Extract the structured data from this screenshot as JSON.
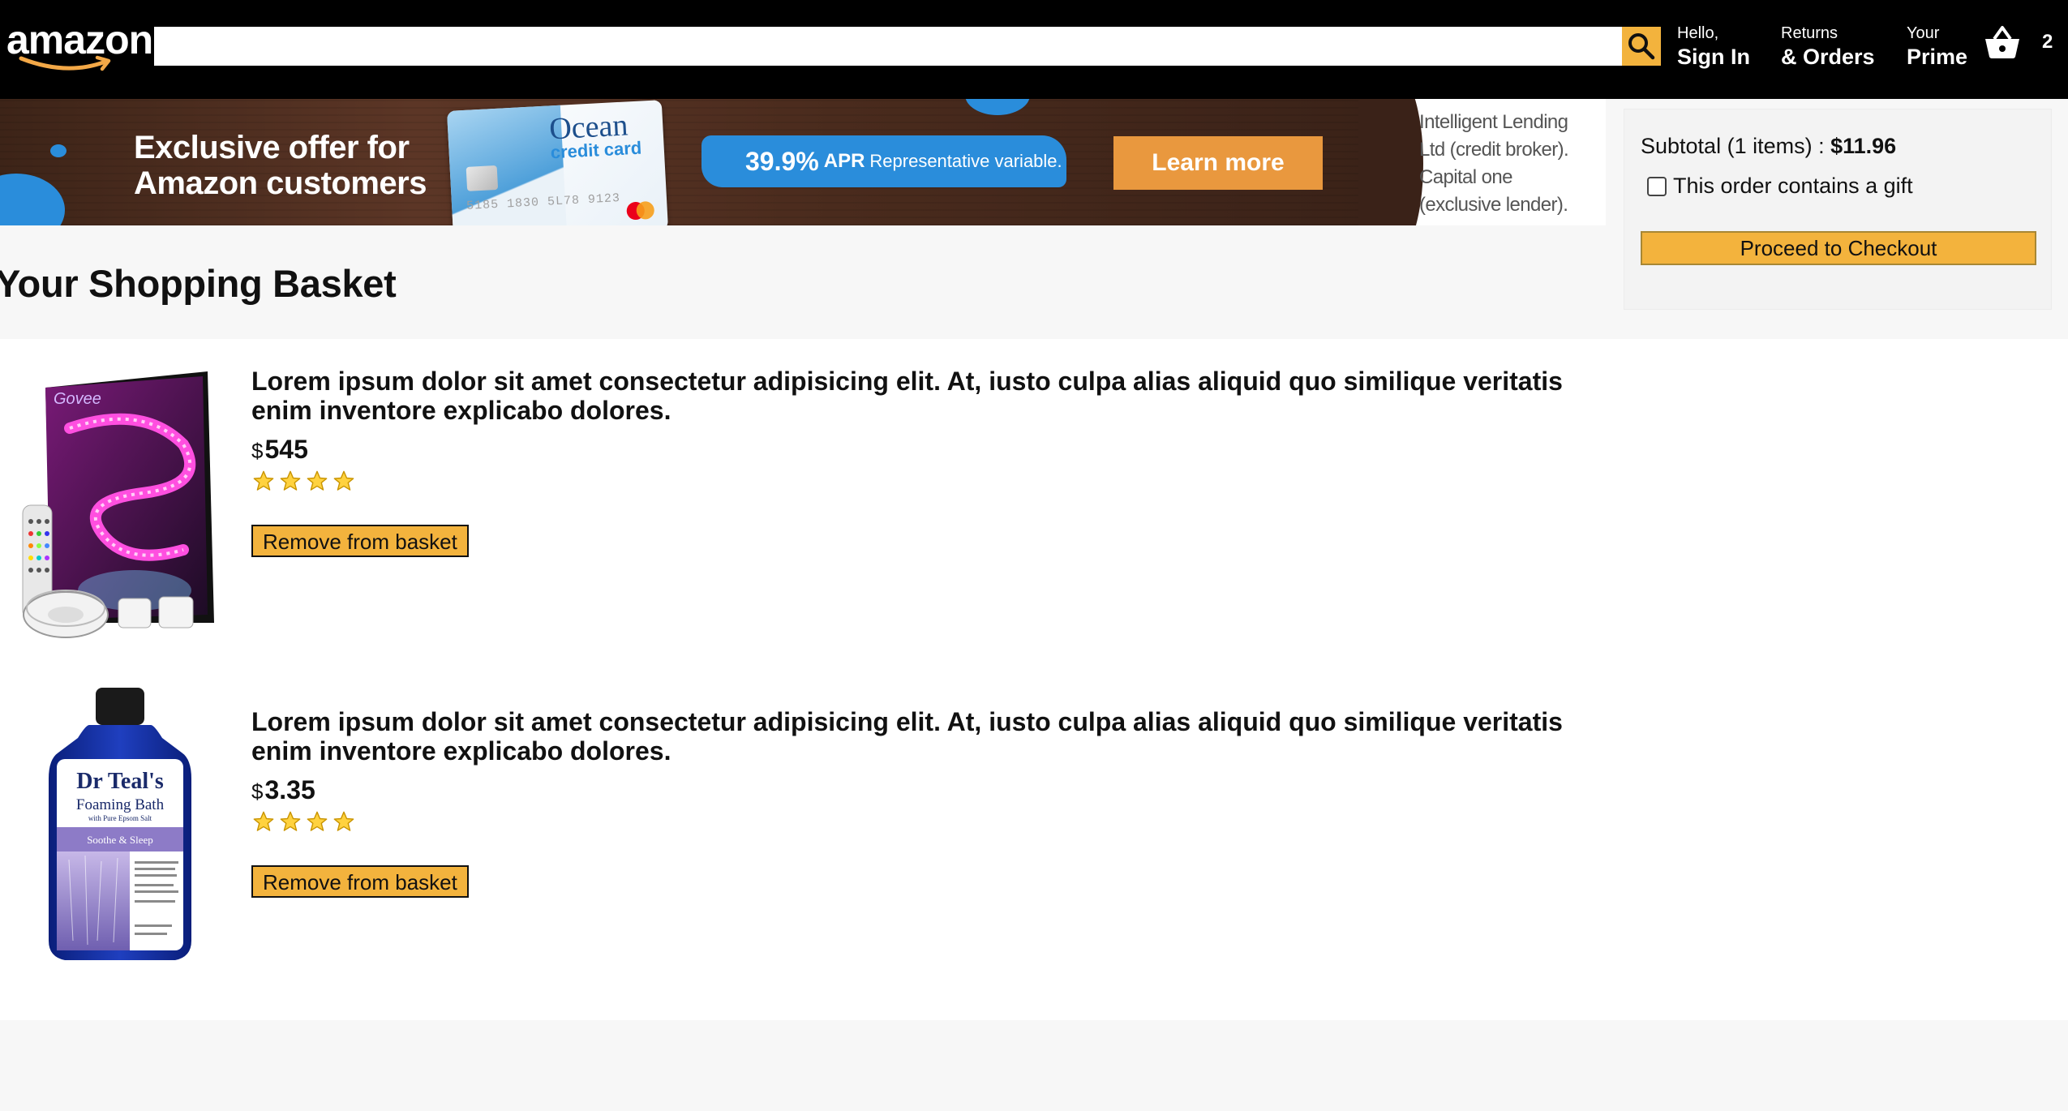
{
  "header": {
    "logo_text": "amazon",
    "search": {
      "value": "",
      "placeholder": ""
    },
    "nav": [
      {
        "line1": "Hello,",
        "line2": "Sign In"
      },
      {
        "line1": "Returns",
        "line2": "& Orders"
      },
      {
        "line1": "Your",
        "line2": "Prime"
      }
    ],
    "basket_count": "2",
    "icons": {
      "search": "search-icon",
      "basket": "basket-icon"
    }
  },
  "ad": {
    "headline_line1": "Exclusive offer for",
    "headline_line2": "Amazon customers",
    "card_title": "Ocean",
    "card_subtitle": "credit card",
    "card_number": "5185 1830 5L78 9123",
    "apr_value": "39.9%",
    "apr_label": "APR",
    "apr_rest": "Representative variable.",
    "cta": "Learn more",
    "legal_line1": "Intelligent Lending",
    "legal_line2": "Ltd (credit broker).",
    "legal_line3": "Capital one",
    "legal_line4": "(exclusive lender)."
  },
  "page": {
    "title": "Your Shopping Basket"
  },
  "items": [
    {
      "title": "Lorem ipsum dolor sit amet consectetur adipisicing elit. At, iusto culpa alias aliquid quo similique veritatis enim inventore explicabo dolores.",
      "currency": "$",
      "price": "545",
      "rating": 4,
      "remove_label": "Remove from basket",
      "image_label": "Govee"
    },
    {
      "title": "Lorem ipsum dolor sit amet consectetur adipisicing elit. At, iusto culpa alias aliquid quo similique veritatis enim inventore explicabo dolores.",
      "currency": "$",
      "price": "3.35",
      "rating": 4,
      "remove_label": "Remove from basket",
      "image_label_1": "Dr Teal's",
      "image_label_2": "Foaming Bath",
      "image_label_3": "with Pure Epsom Salt",
      "image_label_4": "Soothe & Sleep"
    }
  ],
  "subtotal": {
    "label": "Subtotal (1 items) : ",
    "amount": "$11.96",
    "gift_label": "This order contains a gift",
    "gift_checked": false,
    "checkout_label": "Proceed to Checkout"
  },
  "colors": {
    "header_bg": "#000000",
    "accent": "#f3b33d",
    "ad_blue": "#2a8ddb",
    "ad_cta": "#e9983e"
  }
}
